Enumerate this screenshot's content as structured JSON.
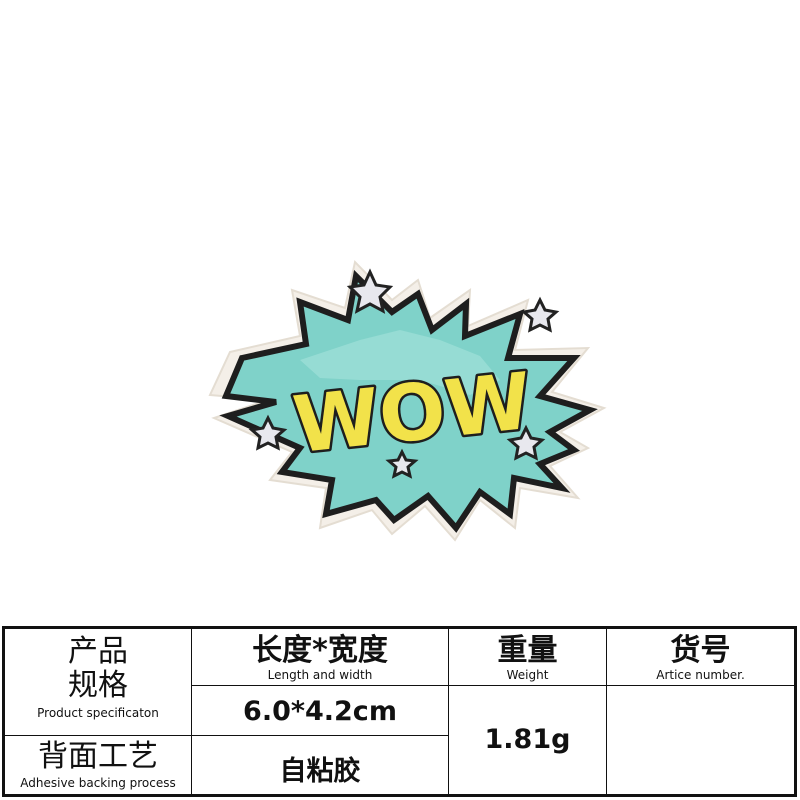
{
  "product_image": {
    "patch_text": "WOW",
    "colors": {
      "burst": "#7fd2c9",
      "burst_light": "#a9e3dc",
      "outline": "#1e1e1e",
      "border": "#f4efe8",
      "lettering": "#f2e24a",
      "star": "#e8e8ee"
    }
  },
  "spec_table": {
    "product_spec_label_line1": "产品",
    "product_spec_label_line2": "规格",
    "product_spec_label_en": "Product specificaton",
    "size_label": "长度*宽度",
    "size_label_en": "Length and width",
    "size_value": "6.0*4.2cm",
    "weight_label": "重量",
    "weight_label_en": "Weight",
    "weight_value": "1.81g",
    "article_label": "货号",
    "article_label_en": "Artice number.",
    "article_value": "",
    "backing_label": "背面工艺",
    "backing_label_en": "Adhesive backing process",
    "backing_value": "自粘胶"
  }
}
